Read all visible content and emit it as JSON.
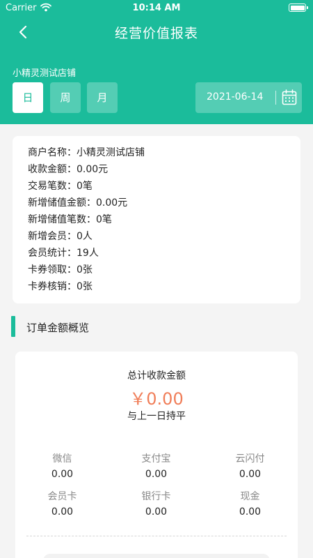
{
  "status_bar": {
    "carrier": "Carrier",
    "time": "10:14 AM"
  },
  "nav": {
    "title": "经营价值报表",
    "back_icon": "chevron-left-icon"
  },
  "store": {
    "name": "小精灵测试店铺"
  },
  "period": {
    "tabs": [
      "日",
      "周",
      "月"
    ],
    "selected": "日"
  },
  "date": {
    "value": "2021-06-14",
    "icon": "calendar-icon"
  },
  "info": {
    "rows": [
      "商户名称：小精灵测试店铺",
      "收款金额：0.00元",
      "交易笔数：0笔",
      "新增储值金额：0.00元",
      "新增储值笔数：0笔",
      "新增会员：0人",
      "会员统计：19人",
      "卡券领取：0张",
      "卡券核销：0张"
    ]
  },
  "section": {
    "title": "订单金额概览"
  },
  "summary": {
    "label": "总计收款金额",
    "value": "￥0.00",
    "compare": "与上一日持平",
    "payments": [
      {
        "name": "微信",
        "value": "0.00"
      },
      {
        "name": "支付宝",
        "value": "0.00"
      },
      {
        "name": "云闪付",
        "value": "0.00"
      },
      {
        "name": "会员卡",
        "value": "0.00"
      },
      {
        "name": "银行卡",
        "value": "0.00"
      },
      {
        "name": "现金",
        "value": "0.00"
      }
    ]
  },
  "colors": {
    "primary": "#1bbc9b",
    "amount": "#f07e59",
    "background": "#f4f4f4"
  }
}
